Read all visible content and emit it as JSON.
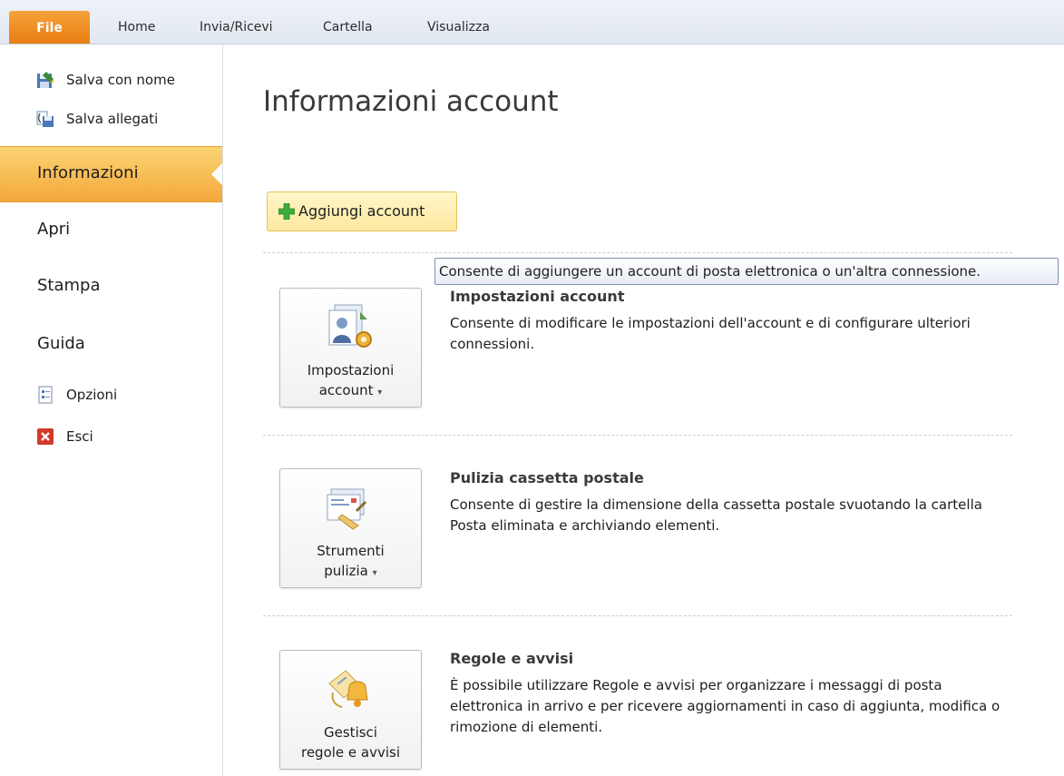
{
  "tabs": {
    "file": "File",
    "home": "Home",
    "send_receive": "Invia/Ricevi",
    "folder": "Cartella",
    "view": "Visualizza"
  },
  "sidebar": {
    "save_as": "Salva con nome",
    "save_attachments": "Salva allegati",
    "info": "Informazioni",
    "open": "Apri",
    "print": "Stampa",
    "help": "Guida",
    "options": "Opzioni",
    "exit": "Esci"
  },
  "main": {
    "title": "Informazioni account",
    "add_account": "Aggiungi account",
    "tooltip": "Consente di aggiungere un account di posta elettronica o un'altra connessione.",
    "sections": [
      {
        "button_line1": "Impostazioni",
        "button_line2": "account",
        "title": "Impostazioni account",
        "description": "Consente di modificare le impostazioni dell'account e di configurare ulteriori connessioni."
      },
      {
        "button_line1": "Strumenti",
        "button_line2": "pulizia",
        "title": "Pulizia cassetta postale",
        "description": "Consente di gestire la dimensione della cassetta postale svuotando la cartella Posta eliminata e archiviando elementi."
      },
      {
        "button_line1": "Gestisci",
        "button_line2": "regole e avvisi",
        "title": "Regole e avvisi",
        "description": "È possibile utilizzare Regole e avvisi per organizzare i messaggi di posta elettronica in arrivo e per ricevere aggiornamenti in caso di aggiunta, modifica o rimozione di elementi."
      }
    ]
  },
  "icons": {
    "save_as": "save-as-icon",
    "save_attachments": "save-attachments-icon",
    "options": "options-icon",
    "exit": "exit-icon",
    "add": "plus-icon",
    "account_settings": "account-settings-icon",
    "cleanup": "cleanup-tools-icon",
    "rules": "rules-alerts-icon"
  },
  "colors": {
    "accent": "#f4a73a",
    "file_tab": "#e87e12"
  }
}
